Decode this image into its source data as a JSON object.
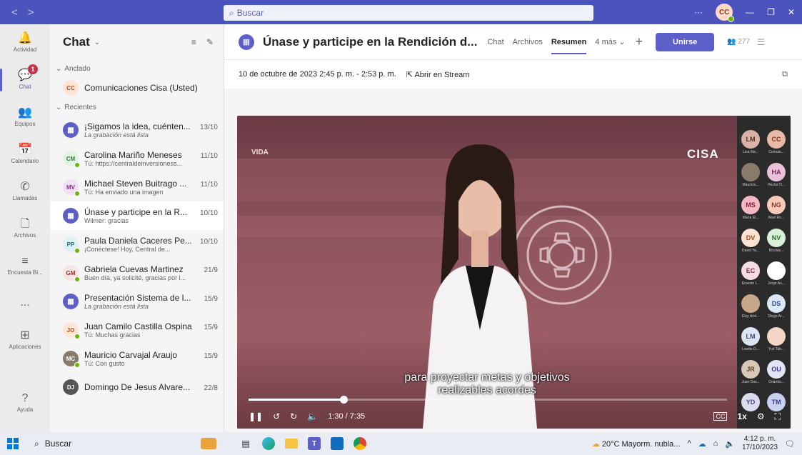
{
  "titlebar": {
    "back": "<",
    "forward": ">",
    "search_placeholder": "Buscar",
    "more": "···",
    "avatar_initials": "CC"
  },
  "rail": [
    {
      "label": "Actividad",
      "icon": "bell-icon",
      "glyph": "🔔"
    },
    {
      "label": "Chat",
      "icon": "chat-icon",
      "glyph": "💬",
      "badge": "1",
      "active": true
    },
    {
      "label": "Equipos",
      "icon": "teams-icon",
      "glyph": "👥"
    },
    {
      "label": "Calendario",
      "icon": "calendar-icon",
      "glyph": "📅"
    },
    {
      "label": "Llamadas",
      "icon": "phone-icon",
      "glyph": "✆"
    },
    {
      "label": "Archivos",
      "icon": "file-icon",
      "glyph": "🗋"
    },
    {
      "label": "Encuesta Bi...",
      "icon": "poll-icon",
      "glyph": "≡"
    },
    {
      "label": "...",
      "icon": "more-icon",
      "glyph": ""
    },
    {
      "label": "Aplicaciones",
      "icon": "apps-icon",
      "glyph": "⊞"
    },
    {
      "label": "Ayuda",
      "icon": "help-icon",
      "glyph": "?"
    }
  ],
  "chatlist": {
    "title": "Chat",
    "pinned_label": "Anclado",
    "recent_label": "Recientes",
    "pinned": [
      {
        "initials": "CC",
        "name": "Comunicaciones Cisa (Usted)",
        "bg": "#fde4d6",
        "fg": "#a34a1c"
      }
    ],
    "items": [
      {
        "type": "meeting",
        "name": "¡Sigamos la idea, cuénten...",
        "date": "13/10",
        "preview": "La grabación está lista",
        "italic": true
      },
      {
        "type": "person",
        "initials": "CM",
        "bg": "#e2f3e2",
        "fg": "#2e7d32",
        "presence": true,
        "name": "Carolina Mariño Meneses",
        "date": "11/10",
        "preview": "Tú: https://centraldeinversioness..."
      },
      {
        "type": "person",
        "initials": "MV",
        "bg": "#efe0f4",
        "fg": "#7b2f91",
        "presence": true,
        "name": "Michael Steven Buitrago ...",
        "date": "11/10",
        "preview": "Tú: Ha enviado una imagen"
      },
      {
        "type": "meeting",
        "name": "Únase y participe en la R...",
        "date": "10/10",
        "preview": "Wilmer: gracias",
        "selected": true
      },
      {
        "type": "person",
        "initials": "PP",
        "bg": "#e0f1f4",
        "fg": "#1f6b7a",
        "presence": true,
        "name": "Paula Daniela Caceres Pe...",
        "date": "10/10",
        "preview": "¡Conéctese! Hoy, Central de..."
      },
      {
        "type": "person",
        "initials": "GM",
        "bg": "#f6e3e3",
        "fg": "#9c2a2a",
        "presence": true,
        "name": "Gabriela Cuevas Martinez",
        "date": "21/9",
        "preview": "Buen día, ya solicité, gracias por l..."
      },
      {
        "type": "meeting",
        "name": "Presentación Sistema de l...",
        "date": "15/9",
        "preview": "La grabación está lista",
        "italic": true
      },
      {
        "type": "person",
        "initials": "JO",
        "bg": "#fde6d8",
        "fg": "#b14a1a",
        "presence": true,
        "name": "Juan Camilo Castilla Ospina",
        "date": "15/9",
        "preview": "Tú: Muchas gracias"
      },
      {
        "type": "person",
        "initials": "MC",
        "bg": "#8a7a6a",
        "fg": "#ffffff",
        "presence": true,
        "name": "Mauricio Carvajal Araujo",
        "date": "15/9",
        "preview": "Tú: Con gusto"
      },
      {
        "type": "person",
        "initials": "DJ",
        "bg": "#555555",
        "fg": "#ffffff",
        "presence": false,
        "name": "Domingo De Jesus Alvare...",
        "date": "22/8",
        "preview": ""
      }
    ]
  },
  "meeting": {
    "title": "Únase y participe en la Rendición d...",
    "tabs": [
      "Chat",
      "Archivos",
      "Resumen",
      "4 más"
    ],
    "active_tab": "Resumen",
    "join_label": "Unirse",
    "participants": "277",
    "datetime": "10 de octubre de 2023 2:45 p. m. - 2:53 p. m.",
    "stream_label": "Abrir en Stream"
  },
  "video": {
    "logo_left": "VIDA",
    "logo_right": "CISA",
    "subtitle_line1": "para proyectar metas y objetivos",
    "subtitle_line2": "realizables acordes",
    "time": "1:30 / 7:35",
    "progress": 0.198,
    "speed": "1x",
    "cc": "CC",
    "gallery": [
      {
        "initials": "LM",
        "name": "Lina Ma...",
        "bg": "#d9b3a8",
        "fg": "#5a2a1e"
      },
      {
        "initials": "CC",
        "name": "Comuni...",
        "bg": "#e8b9a6",
        "fg": "#7a3a22"
      },
      {
        "initials": "",
        "name": "Mauricio...",
        "bg": "#8a7a6a",
        "fg": "#fff"
      },
      {
        "initials": "HA",
        "name": "Hector H...",
        "bg": "#e9c1d8",
        "fg": "#7a2a55"
      },
      {
        "initials": "MS",
        "name": "María El...",
        "bg": "#f3b8c4",
        "fg": "#8a2238"
      },
      {
        "initials": "NG",
        "name": "Noel Ro...",
        "bg": "#f8c8b8",
        "fg": "#8a3a22"
      },
      {
        "initials": "DV",
        "name": "David Ya...",
        "bg": "#fde2d2",
        "fg": "#a04a22"
      },
      {
        "initials": "NV",
        "name": "Nicolás...",
        "bg": "#d8f0d8",
        "fg": "#2e6b2e"
      },
      {
        "initials": "EC",
        "name": "Ernesto I...",
        "bg": "#f4dce6",
        "fg": "#8a2a55"
      },
      {
        "initials": "",
        "name": "Jorge An...",
        "bg": "#ffffff",
        "fg": "#333"
      },
      {
        "initials": "",
        "name": "Eloy Arid...",
        "bg": "#c8a88a",
        "fg": "#fff"
      },
      {
        "initials": "DS",
        "name": "Diego Ar...",
        "bg": "#dbe8f6",
        "fg": "#2a4a8a"
      },
      {
        "initials": "LM",
        "name": "Lisette D...",
        "bg": "#dce4f2",
        "fg": "#3a4a7a"
      },
      {
        "initials": "",
        "name": "Yuri Tab...",
        "bg": "#f2d6c8",
        "fg": "#8a3a22"
      },
      {
        "initials": "JR",
        "name": "Juan Dav...",
        "bg": "#d8c8b8",
        "fg": "#5a3a22"
      },
      {
        "initials": "OU",
        "name": "Orlando...",
        "bg": "#e0e4f4",
        "fg": "#3a3a8a"
      },
      {
        "initials": "YD",
        "name": "",
        "bg": "#dcdcf0",
        "fg": "#4a4a8a"
      },
      {
        "initials": "TM",
        "name": "",
        "bg": "#c8d0f0",
        "fg": "#3a3a8a"
      }
    ]
  },
  "taskbar": {
    "search": "Buscar",
    "weather": "20°C  Mayorm. nubla...",
    "time": "4:12 p. m.",
    "date": "17/10/2023"
  },
  "colors": {
    "brand": "#5b5fc7",
    "titlebar": "#4b53bc"
  }
}
